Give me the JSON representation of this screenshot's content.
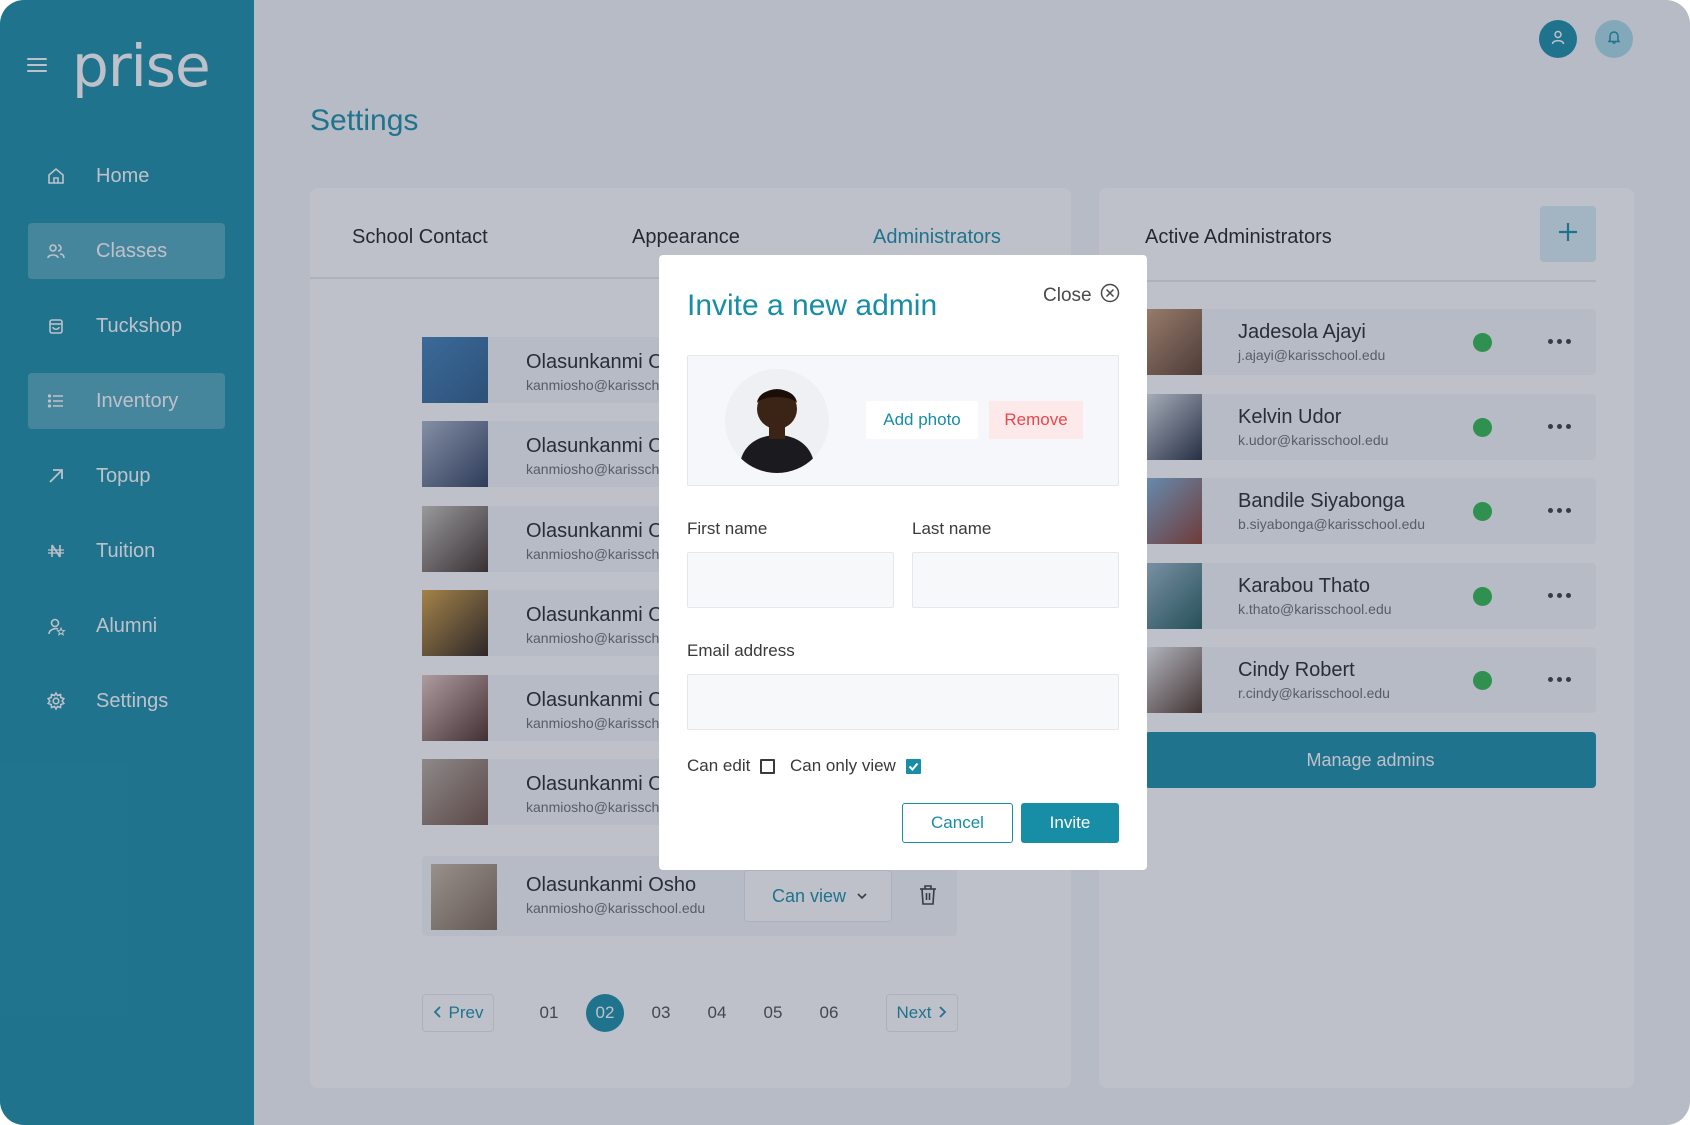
{
  "app": {
    "logo": "prise",
    "brand_color": "#178da6"
  },
  "sidebar": {
    "items": [
      {
        "label": "Home",
        "icon": "home-icon",
        "active": false
      },
      {
        "label": "Classes",
        "icon": "users-icon",
        "active": true
      },
      {
        "label": "Tuckshop",
        "icon": "shopping-bag-icon",
        "active": false
      },
      {
        "label": "Inventory",
        "icon": "list-icon",
        "active": true
      },
      {
        "label": "Topup",
        "icon": "arrow-up-right-icon",
        "active": false
      },
      {
        "label": "Tuition",
        "icon": "naira-icon",
        "active": false
      },
      {
        "label": "Alumni",
        "icon": "user-star-icon",
        "active": false
      },
      {
        "label": "Settings",
        "icon": "gear-icon",
        "active": false
      }
    ]
  },
  "header": {
    "title": "Settings"
  },
  "tabs": [
    {
      "label": "School Contact",
      "active": false
    },
    {
      "label": "Appearance",
      "active": false
    },
    {
      "label": "Administrators",
      "active": true
    }
  ],
  "admin_list": {
    "rows": [
      {
        "name": "Olasunkanmi Osho",
        "email": "kanmiosho@karisschool.edu"
      },
      {
        "name": "Olasunkanmi Osho",
        "email": "kanmiosho@karisschool.edu"
      },
      {
        "name": "Olasunkanmi Osho",
        "email": "kanmiosho@karisschool.edu"
      },
      {
        "name": "Olasunkanmi Osho",
        "email": "kanmiosho@karisschool.edu"
      },
      {
        "name": "Olasunkanmi Osho",
        "email": "kanmiosho@karisschool.edu"
      },
      {
        "name": "Olasunkanmi Osho",
        "email": "kanmiosho@karisschool.edu"
      },
      {
        "name": "Olasunkanmi Osho",
        "email": "kanmiosho@karisschool.edu",
        "permission": "Can view"
      }
    ]
  },
  "pagination": {
    "prev": "Prev",
    "next": "Next",
    "pages": [
      "01",
      "02",
      "03",
      "04",
      "05",
      "06"
    ],
    "current": "02"
  },
  "active_admins": {
    "title": "Active Administrators",
    "items": [
      {
        "name": "Jadesola Ajayi",
        "email": "j.ajayi@karisschool.edu",
        "status_color": "#2eb74a"
      },
      {
        "name": "Kelvin Udor",
        "email": "k.udor@karisschool.edu",
        "status_color": "#2eb74a"
      },
      {
        "name": "Bandile Siyabonga",
        "email": "b.siyabonga@karisschool.edu",
        "status_color": "#2eb74a"
      },
      {
        "name": "Karabou Thato",
        "email": "k.thato@karisschool.edu",
        "status_color": "#2eb74a"
      },
      {
        "name": "Cindy Robert",
        "email": "r.cindy@karisschool.edu",
        "status_color": "#2eb74a"
      }
    ],
    "manage_label": "Manage admins"
  },
  "modal": {
    "title": "Invite a new admin",
    "close_label": "Close",
    "add_photo_label": "Add photo",
    "remove_label": "Remove",
    "first_name_label": "First name",
    "last_name_label": "Last name",
    "email_label": "Email address",
    "first_name_value": "",
    "last_name_value": "",
    "email_value": "",
    "can_edit_label": "Can edit",
    "can_edit_checked": false,
    "can_only_view_label": "Can only view",
    "can_only_view_checked": true,
    "cancel_label": "Cancel",
    "invite_label": "Invite"
  }
}
